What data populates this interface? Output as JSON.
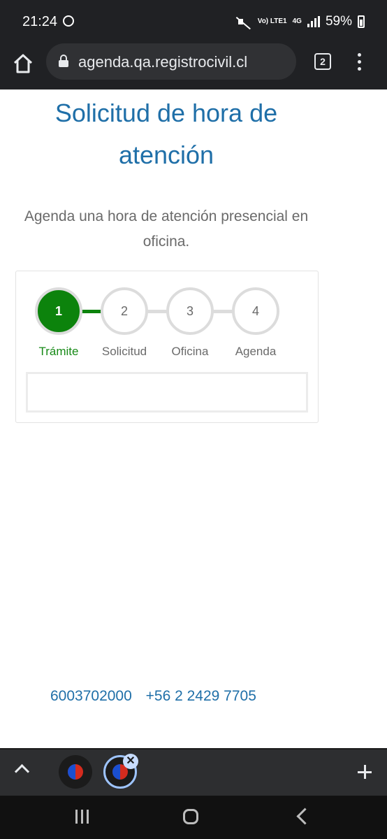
{
  "status_bar": {
    "time": "21:24",
    "volte": "Vo) LTE1",
    "network": "4G",
    "battery": "59%"
  },
  "browser": {
    "url": "agenda.qa.registrocivil.cl",
    "tab_count": "2"
  },
  "page": {
    "title": "Solicitud de hora de atención",
    "intro": "Agenda una hora de atención presencial en oficina.",
    "steps": [
      {
        "number": "1",
        "label": "Trámite",
        "active": true
      },
      {
        "number": "2",
        "label": "Solicitud",
        "active": false
      },
      {
        "number": "3",
        "label": "Oficina",
        "active": false
      },
      {
        "number": "4",
        "label": "Agenda",
        "active": false
      }
    ],
    "accent_color": "#0c830c",
    "link_color": "#1f6fa8"
  },
  "footer": {
    "phone_1": "6003702000",
    "phone_2": "+56 2 2429 7705"
  },
  "tab_strip": {
    "close_label": "✕"
  }
}
